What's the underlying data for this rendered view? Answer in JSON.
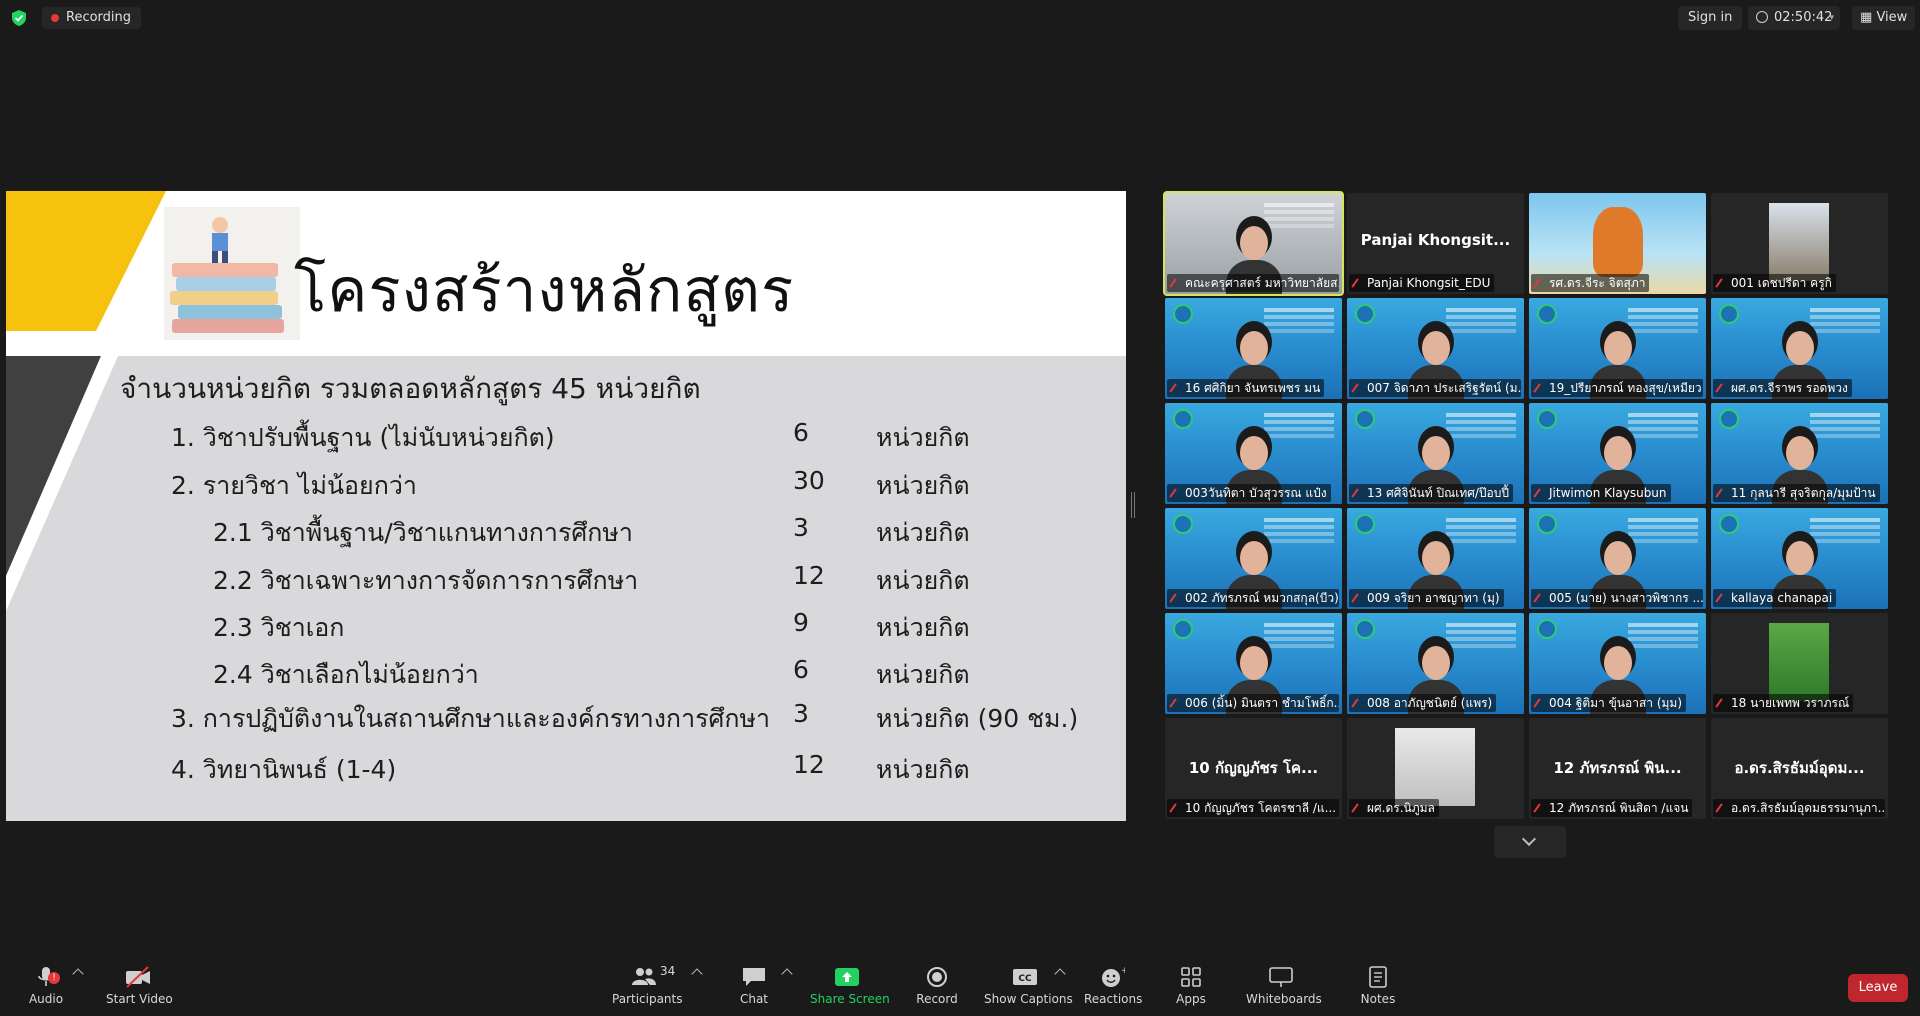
{
  "topbar": {
    "recording": "Recording",
    "sign_in": "Sign in",
    "timer": "02:50:42",
    "view": "View"
  },
  "slide": {
    "title": "โครงสร้างหลักสูตร",
    "heading": "จำนวนหน่วยกิต รวมตลอดหลักสูตร 45 หน่วยกิต",
    "rows": [
      {
        "label": "1. วิชาปรับพื้นฐาน (ไม่นับหน่วยกิต)",
        "num": "6",
        "unit": "หน่วยกิต"
      },
      {
        "label": "2. รายวิชา ไม่น้อยกว่า",
        "num": "30",
        "unit": "หน่วยกิต"
      },
      {
        "label": "2.1 วิชาพื้นฐาน/วิชาแกนทางการศึกษา",
        "num": "3",
        "unit": "หน่วยกิต"
      },
      {
        "label": "2.2 วิชาเฉพาะทางการจัดการการศึกษา",
        "num": "12",
        "unit": "หน่วยกิต"
      },
      {
        "label": "2.3 วิชาเอก",
        "num": "9",
        "unit": "หน่วยกิต"
      },
      {
        "label": "2.4 วิชาเลือกไม่น้อยกว่า",
        "num": "6",
        "unit": "หน่วยกิต"
      },
      {
        "label": "3. การปฏิบัติงานในสถานศึกษาและองค์กรทางการศึกษา",
        "num": "3",
        "unit": "หน่วยกิต (90 ชม.)"
      },
      {
        "label": "4. วิทยานิพนธ์ (1-4)",
        "num": "12",
        "unit": "หน่วยกิต"
      }
    ]
  },
  "gallery": {
    "tiles": [
      {
        "name": "คณะครุศาสตร์ มหาวิทยาลัยส...",
        "kind": "speaker"
      },
      {
        "name": "Panjai Khongsit_EDU",
        "big": "Panjai Khongsit...",
        "kind": "dark"
      },
      {
        "name": "รศ.ดร.จีระ จิตสุภา",
        "kind": "fox"
      },
      {
        "name": "001 เดชปรีดา ครูกิ",
        "kind": "outdoor"
      },
      {
        "name": "16 ศศิกิยา จันทรเพชร มน",
        "kind": "bg"
      },
      {
        "name": "007 จิดาภา ประเสริฐรัตน์ (ม...",
        "kind": "bg"
      },
      {
        "name": "19_ปรียาภรณ์ ทองสุข/เหมียว",
        "kind": "bg"
      },
      {
        "name": "ผศ.ดร.จีราพร รอดพวง",
        "kind": "bg"
      },
      {
        "name": "003วันทิตา บัวสุวรรณ แป๋ง",
        "kind": "bg"
      },
      {
        "name": "13 ศศิจินันท์ ปิณเทศ/ป๊อบปี้",
        "kind": "bg"
      },
      {
        "name": "Jitwimon Klaysubun",
        "kind": "bg"
      },
      {
        "name": "11 กุลนารี สุจริตกุล/มุมป้าน",
        "kind": "bg"
      },
      {
        "name": "002 ภัทรภรณ์ หมวกสกุล(บีว)",
        "kind": "bg"
      },
      {
        "name": "009 จริยา อาชญาทา (มุ)",
        "kind": "bg"
      },
      {
        "name": "005 (มาย) นางสาวพิชากร ...",
        "kind": "bg"
      },
      {
        "name": "kallaya chanapai",
        "kind": "bg"
      },
      {
        "name": "006 (มิ้น) มินตรา ชำมโพธิ์ก...",
        "kind": "bg"
      },
      {
        "name": "008 อาภัญชนิตย์ (แพร)",
        "kind": "bg"
      },
      {
        "name": "004 ฐิติมา ขุ้นอาสา (มุม)",
        "kind": "bg"
      },
      {
        "name": "18 นายเพทพ วราภรณ์",
        "kind": "green"
      },
      {
        "name": "10 กัญญภัชร โคตรชาลี /แ...",
        "big": "10 กัญญภัชร โค...",
        "kind": "dark"
      },
      {
        "name": "ผศ.ดร.นิภูมล",
        "kind": "photo"
      },
      {
        "name": "12 ภัทรภรณ์ พินสิดา /แจน",
        "big": "12 ภัทรภรณ์ พิน...",
        "kind": "dark"
      },
      {
        "name": "อ.ดร.สิรธัมม์อุดมธรรมานุภา...",
        "big": "อ.ดร.สิรธัมม์อุดม...",
        "kind": "dark"
      }
    ]
  },
  "toolbar": {
    "audio": "Audio",
    "start_video": "Start Video",
    "participants_count": "34",
    "participants": "Participants",
    "chat": "Chat",
    "share_screen": "Share Screen",
    "record": "Record",
    "show_captions": "Show Captions",
    "reactions": "Reactions",
    "apps": "Apps",
    "whiteboards": "Whiteboards",
    "notes": "Notes",
    "leave": "Leave",
    "audio_badge": "!"
  },
  "colors": {
    "accent_yellow": "#f6c20e",
    "share_green": "#23d160",
    "leave_red": "#c0262d",
    "active_speaker": "#d5e45b"
  }
}
